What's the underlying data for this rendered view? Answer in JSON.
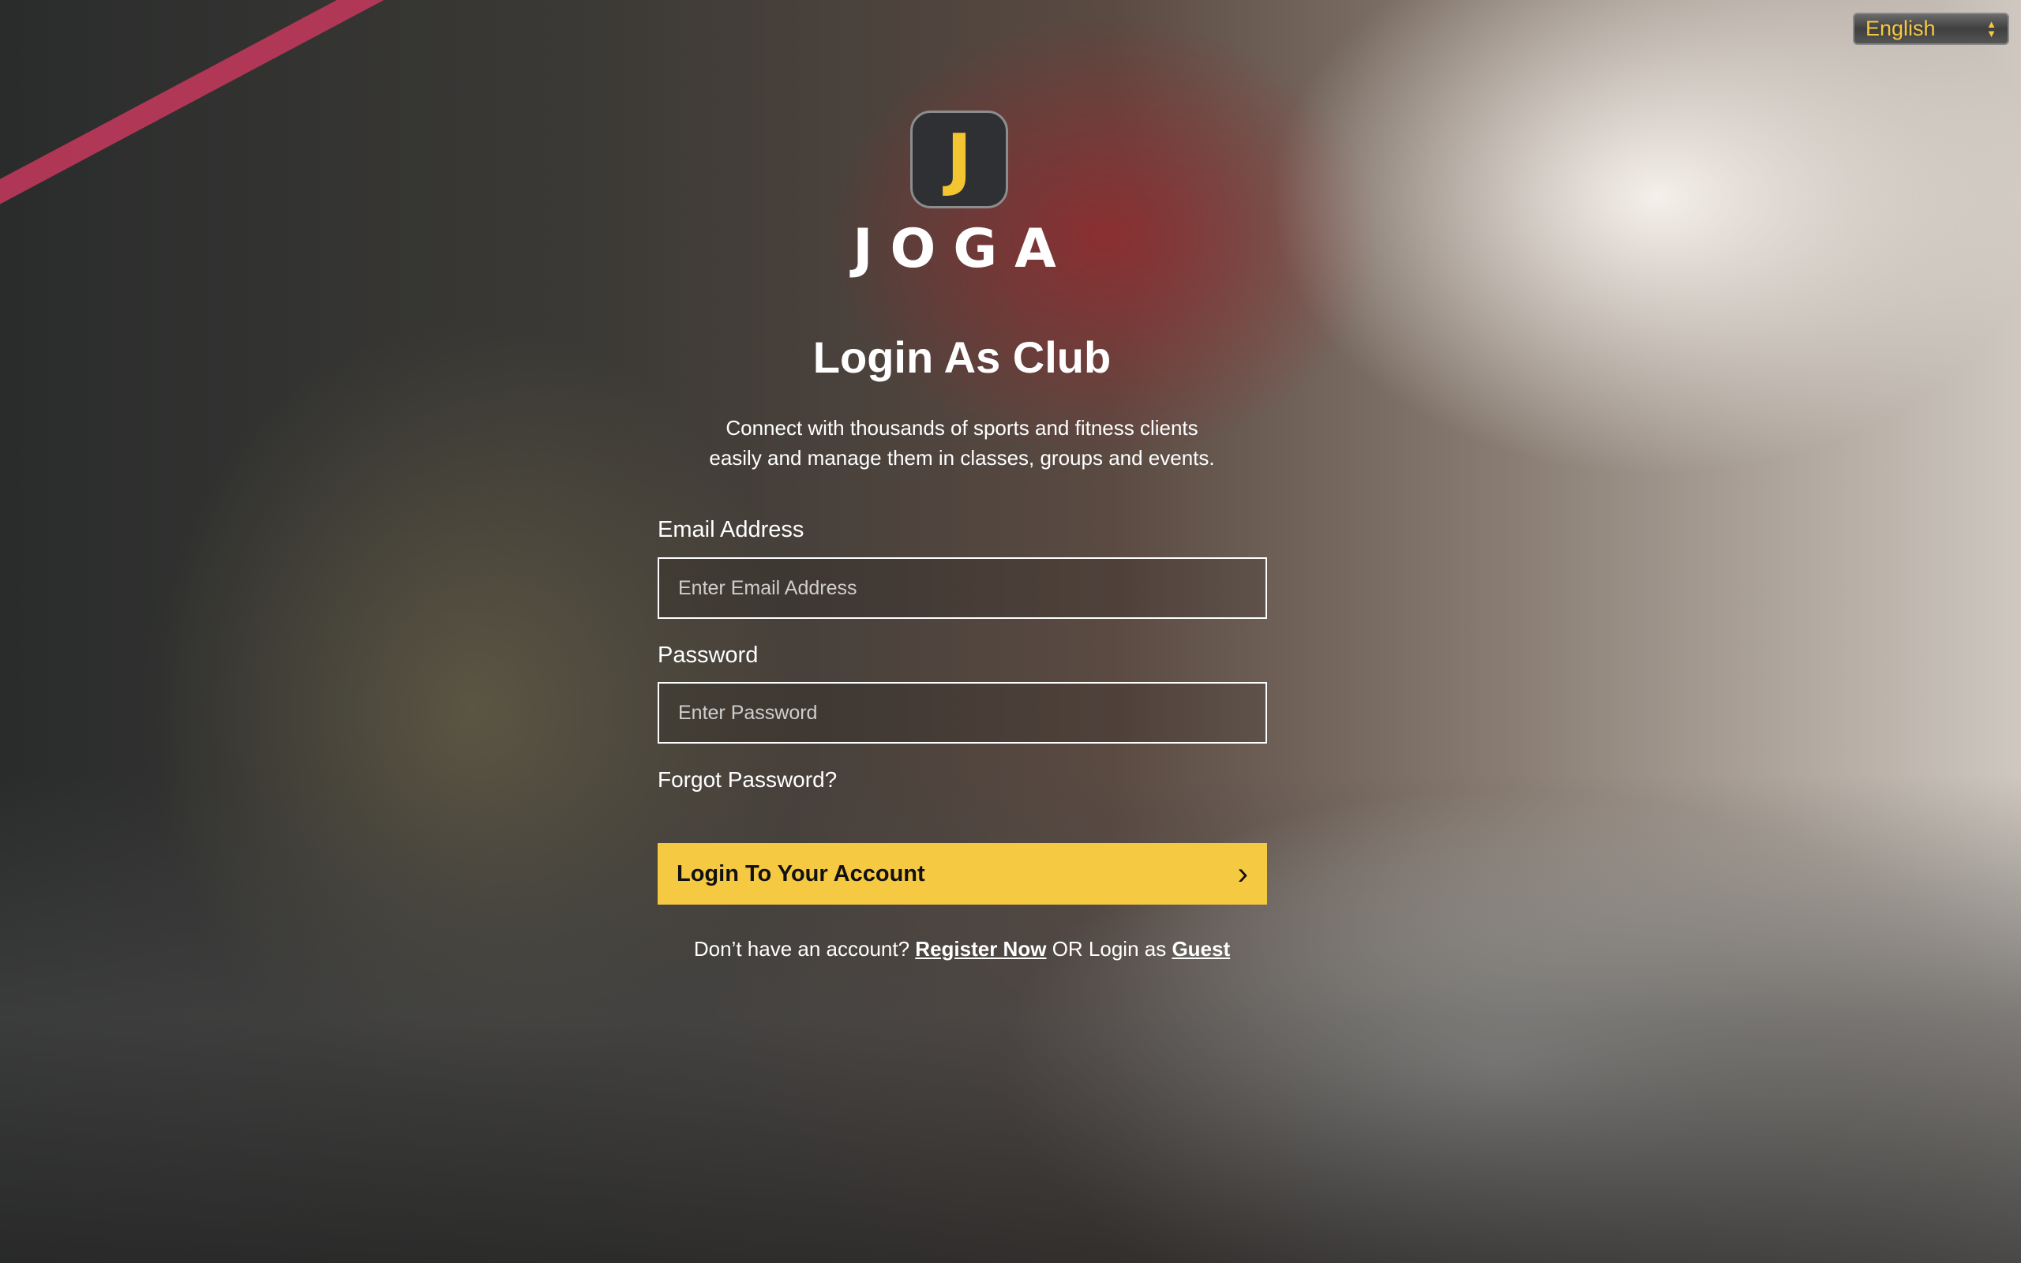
{
  "language": {
    "selected": "English"
  },
  "brand": {
    "logo_letter": "J",
    "name": "JOGA"
  },
  "title": "Login As Club",
  "description": [
    "Connect with thousands of sports and fitness clients",
    "easily and manage them in classes, groups and events."
  ],
  "email": {
    "label": "Email Address",
    "placeholder": "Enter Email Address",
    "value": ""
  },
  "password": {
    "label": "Password",
    "placeholder": "Enter Password",
    "value": ""
  },
  "forgot": "Forgot Password?",
  "login_button": "Login To Your Account",
  "footer": {
    "prefix": "Don’t have an account?",
    "register": "Register Now",
    "middle": "OR Login as",
    "guest": "Guest"
  },
  "colors": {
    "accent": "#f6c942"
  }
}
